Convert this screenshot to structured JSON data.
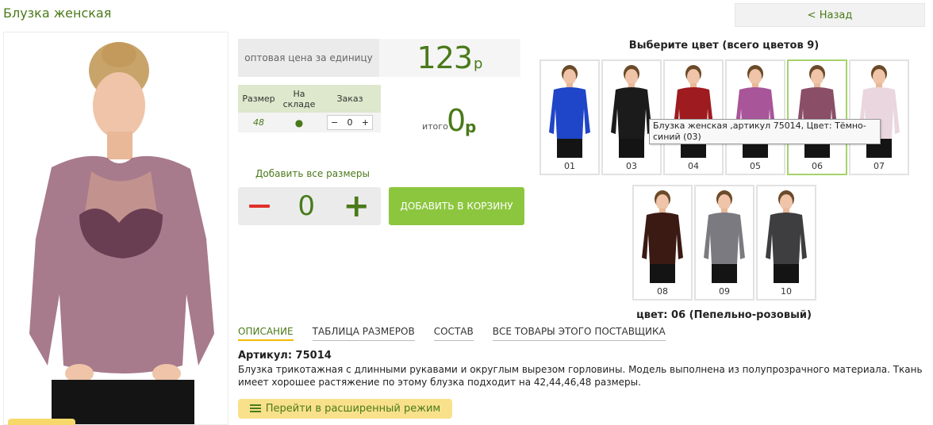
{
  "header": {
    "title": "Блузка женская",
    "back_label": "< Назад"
  },
  "price": {
    "label": "оптовая цена за единицу",
    "value": "123",
    "currency": "р"
  },
  "size_table": {
    "headers": [
      "Размер",
      "На складе",
      "Заказ"
    ],
    "rows": [
      {
        "size": "48",
        "stock": "●",
        "qty": "0"
      }
    ]
  },
  "total": {
    "label": "итого",
    "value": "0",
    "currency": "р"
  },
  "bulk": {
    "label": "Добавить все размеры",
    "qty": "0",
    "add_to_cart": "ДОБАВИТЬ В КОРЗИНУ"
  },
  "colors": {
    "heading": "Выберите цвет (всего цветов 9)",
    "items": [
      {
        "code": "01",
        "color": "#1f45c8"
      },
      {
        "code": "03",
        "color": "#1b1b1b"
      },
      {
        "code": "04",
        "color": "#9e1b1f"
      },
      {
        "code": "05",
        "color": "#a8559a"
      },
      {
        "code": "06",
        "color": "#8a4e66"
      },
      {
        "code": "07",
        "color": "#e9d6df"
      },
      {
        "code": "08",
        "color": "#3b1a14"
      },
      {
        "code": "09",
        "color": "#7a7a80"
      },
      {
        "code": "10",
        "color": "#3e3e40"
      }
    ],
    "tooltip": "Блузка женская ,артикул 75014, Цвет: Тёмно-синий (03)",
    "selected": "цвет: 06 (Пепельно-розовый)"
  },
  "tabs": [
    "ОПИСАНИЕ",
    "ТАБЛИЦА РАЗМЕРОВ",
    "СОСТАВ",
    "ВСЕ ТОВАРЫ ЭТОГО ПОСТАВЩИКА"
  ],
  "description": {
    "title": "Артикул: 75014",
    "text": "Блузка трикотажная с длинными рукавами и округлым вырезом горловины. Модель выполнена из полупрозрачного материала. Ткань имеет хорошее растяжение по этому блузка подходит на 42,44,46,48 размеры."
  },
  "advanced_mode": "Перейти в расширенный режим",
  "accent_colors": {
    "green": "#4a7a1a",
    "button_green": "#8cc63f",
    "yellow": "#f9e18c"
  }
}
